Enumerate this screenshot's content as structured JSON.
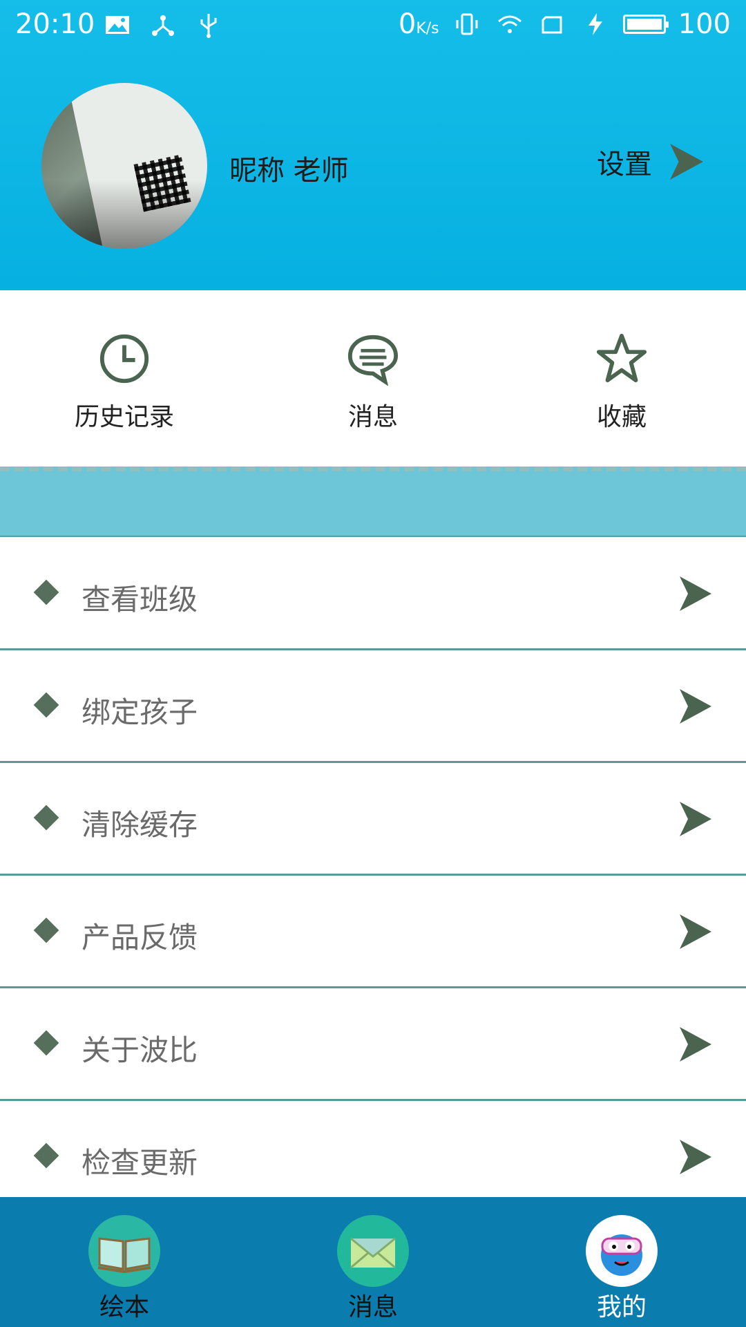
{
  "statusbar": {
    "time": "20:10",
    "net_speed": "0",
    "net_unit": "K/s",
    "battery": "100"
  },
  "profile": {
    "nickname": "昵称 老师",
    "settings_label": "设置"
  },
  "quick_actions": [
    {
      "label": "历史记录",
      "icon": "clock-icon"
    },
    {
      "label": "消息",
      "icon": "chat-bubble-icon"
    },
    {
      "label": "收藏",
      "icon": "star-icon"
    }
  ],
  "menu": [
    {
      "label": "查看班级"
    },
    {
      "label": "绑定孩子"
    },
    {
      "label": "清除缓存"
    },
    {
      "label": "产品反馈"
    },
    {
      "label": "关于波比"
    },
    {
      "label": "检查更新"
    }
  ],
  "bottom_nav": [
    {
      "label": "绘本",
      "icon": "book-icon",
      "active": false
    },
    {
      "label": "消息",
      "icon": "envelope-icon",
      "active": false
    },
    {
      "label": "我的",
      "icon": "mascot-icon",
      "active": true
    }
  ],
  "colors": {
    "header_blue": "#0db4e6",
    "band": "#6cc6d8",
    "icon_green": "#4a6450",
    "bottom_bar": "#0a7dae"
  }
}
